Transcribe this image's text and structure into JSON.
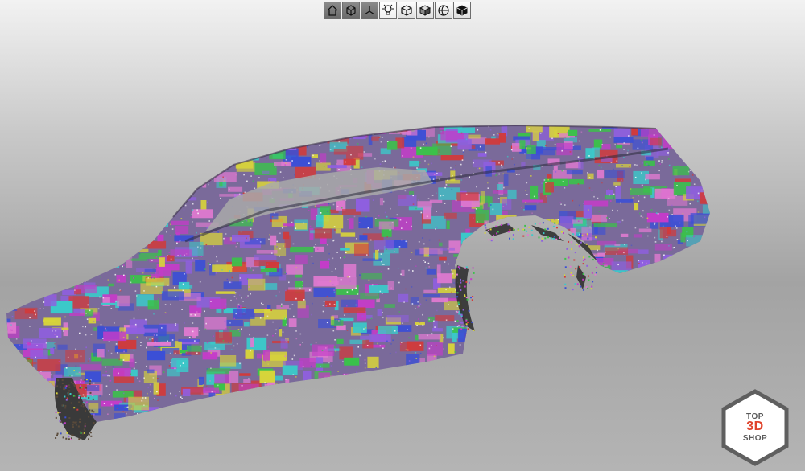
{
  "toolbar": {
    "buttons": [
      {
        "icon": "home-icon",
        "style": "dark"
      },
      {
        "icon": "fit-view-icon",
        "style": "dark"
      },
      {
        "icon": "axes-view-icon",
        "style": "dark"
      },
      {
        "icon": "light-bulb-icon",
        "style": "active"
      },
      {
        "icon": "wireframe-cube-icon",
        "style": "normal"
      },
      {
        "icon": "shaded-cube-icon",
        "style": "normal"
      },
      {
        "icon": "sphere-view-icon",
        "style": "normal"
      },
      {
        "icon": "solid-cube-icon",
        "style": "normal"
      }
    ]
  },
  "logo": {
    "line1": "TOP",
    "line2": "3D",
    "line3": "SHOP",
    "accent_color": "#e0432b",
    "text_color": "#5a5a5a"
  },
  "scan": {
    "description_colors": [
      "#c43cc8",
      "#3ac24a",
      "#3b4fd6",
      "#d8d43a",
      "#3bc9c9",
      "#d23a3a",
      "#8f5fe0",
      "#e07ad0"
    ]
  }
}
